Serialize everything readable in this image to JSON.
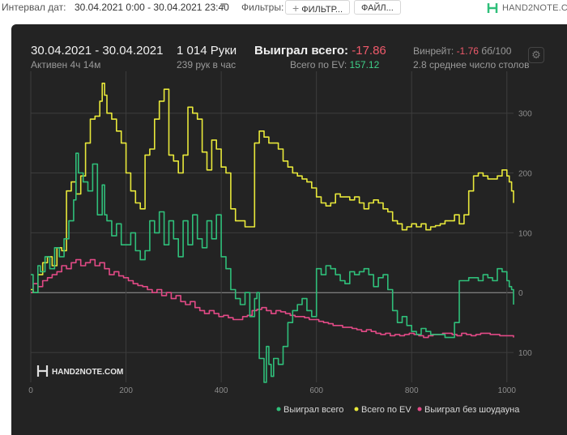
{
  "topbar": {
    "date_label": "Интервал дат:",
    "date_value": "30.04.2021 0:00 - 30.04.2021 23:40",
    "filters_label": "Фильтры:",
    "filter_button": "ФИЛЬТР...",
    "files_button": "ФАЙЛ...",
    "logo_text": "HAND2NOTE.COM"
  },
  "stats": {
    "date_range": "30.04.2021 - 30.04.2021",
    "active": "Активен 4ч 14м",
    "hands": "1 014 Руки",
    "hands_per_hour": "239 рук в час",
    "won_label": "Выиграл всего:",
    "won_value": "-17.86",
    "ev_label": "Всего по EV:",
    "ev_value": "157.12",
    "winrate_label": "Винрейт:",
    "winrate_value": "-1.76",
    "winrate_unit": "бб/100",
    "tables": "2.8 среднее число столов"
  },
  "watermark": "HAND2NOTE.COM",
  "colors": {
    "won": "#2fbf7a",
    "ev": "#e8e83a",
    "nosd": "#e24a86",
    "panel": "#232323"
  },
  "chart_data": {
    "type": "line",
    "xlim": [
      0,
      1014
    ],
    "ylim": [
      -150,
      370
    ],
    "x_ticks": [
      0,
      200,
      400,
      600,
      800,
      1000
    ],
    "y_ticks": [
      300,
      200,
      100,
      0,
      -100
    ],
    "y_tick_labels": [
      "300",
      "200",
      "100",
      "0",
      "100"
    ],
    "grid": true,
    "legend_position": "bottom",
    "series": [
      {
        "name": "Выиграл всего",
        "color": "#2fbf7a",
        "x": [
          0,
          5,
          15,
          20,
          30,
          40,
          50,
          60,
          70,
          80,
          90,
          95,
          100,
          110,
          120,
          130,
          140,
          150,
          155,
          160,
          170,
          180,
          190,
          200,
          210,
          220,
          230,
          240,
          250,
          260,
          270,
          280,
          290,
          300,
          310,
          320,
          330,
          340,
          350,
          360,
          370,
          380,
          390,
          400,
          410,
          420,
          430,
          440,
          450,
          460,
          470,
          475,
          480,
          490,
          495,
          500,
          505,
          510,
          520,
          530,
          540,
          550,
          560,
          570,
          580,
          590,
          600,
          610,
          620,
          630,
          640,
          650,
          660,
          670,
          680,
          690,
          700,
          710,
          720,
          730,
          740,
          750,
          760,
          770,
          780,
          790,
          800,
          810,
          820,
          830,
          840,
          850,
          860,
          870,
          880,
          890,
          900,
          910,
          920,
          930,
          940,
          950,
          960,
          970,
          980,
          990,
          1000,
          1005,
          1010,
          1014
        ],
        "y": [
          30,
          0,
          45,
          35,
          60,
          40,
          75,
          60,
          90,
          120,
          155,
          233,
          200,
          185,
          170,
          215,
          130,
          180,
          130,
          120,
          95,
          115,
          80,
          80,
          100,
          70,
          55,
          70,
          120,
          100,
          135,
          80,
          120,
          90,
          60,
          120,
          80,
          130,
          90,
          75,
          120,
          90,
          130,
          60,
          40,
          5,
          -10,
          -20,
          0,
          -40,
          -10,
          0,
          -110,
          -150,
          -90,
          -120,
          -140,
          -110,
          -120,
          -90,
          -50,
          -30,
          -20,
          -10,
          -30,
          -40,
          40,
          30,
          45,
          40,
          30,
          20,
          15,
          35,
          30,
          35,
          40,
          30,
          10,
          25,
          30,
          5,
          -30,
          -50,
          -40,
          -55,
          -65,
          -70,
          -60,
          -65,
          -70,
          -70,
          -70,
          -75,
          -75,
          -50,
          20,
          20,
          25,
          25,
          20,
          30,
          25,
          20,
          40,
          35,
          20,
          10,
          5,
          -20
        ]
      },
      {
        "name": "Всего по EV",
        "color": "#e8e83a",
        "x": [
          0,
          5,
          15,
          25,
          35,
          45,
          55,
          65,
          75,
          85,
          95,
          105,
          115,
          125,
          135,
          145,
          150,
          155,
          160,
          170,
          180,
          190,
          200,
          210,
          220,
          230,
          240,
          250,
          260,
          270,
          280,
          290,
          300,
          310,
          320,
          330,
          340,
          350,
          360,
          370,
          380,
          390,
          400,
          410,
          420,
          430,
          440,
          450,
          460,
          470,
          480,
          490,
          500,
          510,
          520,
          530,
          540,
          550,
          560,
          570,
          580,
          590,
          600,
          610,
          620,
          630,
          640,
          650,
          660,
          670,
          680,
          690,
          700,
          710,
          720,
          730,
          740,
          750,
          760,
          770,
          780,
          790,
          800,
          810,
          820,
          830,
          840,
          850,
          860,
          870,
          880,
          890,
          900,
          910,
          920,
          930,
          940,
          950,
          960,
          970,
          980,
          990,
          1000,
          1005,
          1010,
          1014
        ],
        "y": [
          5,
          0,
          30,
          50,
          60,
          45,
          75,
          70,
          170,
          185,
          165,
          195,
          250,
          290,
          295,
          320,
          350,
          330,
          300,
          290,
          270,
          250,
          200,
          170,
          150,
          140,
          230,
          240,
          290,
          320,
          340,
          230,
          220,
          200,
          230,
          310,
          300,
          290,
          235,
          205,
          255,
          240,
          210,
          200,
          140,
          120,
          120,
          110,
          110,
          250,
          270,
          260,
          250,
          250,
          240,
          220,
          210,
          200,
          195,
          190,
          185,
          175,
          160,
          150,
          145,
          150,
          165,
          160,
          160,
          155,
          160,
          150,
          140,
          150,
          155,
          150,
          140,
          135,
          120,
          115,
          105,
          110,
          115,
          110,
          115,
          105,
          110,
          112,
          115,
          120,
          120,
          130,
          115,
          130,
          170,
          195,
          200,
          195,
          190,
          190,
          195,
          205,
          195,
          185,
          170,
          150
        ]
      },
      {
        "name": "Выиграл без шоудауна",
        "color": "#e24a86",
        "x": [
          0,
          5,
          15,
          25,
          35,
          45,
          55,
          65,
          75,
          85,
          95,
          105,
          115,
          125,
          135,
          145,
          155,
          165,
          175,
          185,
          195,
          205,
          215,
          225,
          235,
          245,
          255,
          265,
          275,
          285,
          295,
          305,
          315,
          325,
          335,
          345,
          355,
          365,
          375,
          385,
          395,
          405,
          415,
          425,
          435,
          445,
          455,
          465,
          475,
          485,
          495,
          505,
          515,
          525,
          535,
          545,
          555,
          565,
          575,
          585,
          595,
          605,
          615,
          625,
          635,
          645,
          655,
          665,
          675,
          685,
          695,
          705,
          715,
          725,
          735,
          745,
          755,
          765,
          775,
          785,
          795,
          805,
          815,
          825,
          835,
          845,
          855,
          865,
          875,
          885,
          895,
          905,
          915,
          925,
          935,
          945,
          955,
          965,
          975,
          985,
          995,
          1005,
          1014
        ],
        "y": [
          0,
          15,
          10,
          20,
          25,
          30,
          35,
          45,
          40,
          50,
          55,
          45,
          50,
          55,
          45,
          50,
          40,
          30,
          35,
          28,
          25,
          20,
          15,
          12,
          10,
          5,
          0,
          5,
          -5,
          0,
          -10,
          -5,
          -15,
          -20,
          -15,
          -25,
          -30,
          -35,
          -30,
          -35,
          -40,
          -38,
          -42,
          -45,
          -45,
          -40,
          -38,
          -30,
          -28,
          -25,
          -30,
          -35,
          -30,
          -32,
          -35,
          -38,
          -40,
          -40,
          -42,
          -45,
          -45,
          -48,
          -50,
          -52,
          -55,
          -55,
          -58,
          -58,
          -60,
          -62,
          -65,
          -62,
          -65,
          -68,
          -70,
          -68,
          -72,
          -70,
          -72,
          -70,
          -68,
          -70,
          -72,
          -75,
          -72,
          -70,
          -70,
          -68,
          -68,
          -70,
          -72,
          -68,
          -70,
          -72,
          -70,
          -68,
          -68,
          -70,
          -70,
          -72,
          -72,
          -72,
          -75
        ]
      }
    ]
  }
}
